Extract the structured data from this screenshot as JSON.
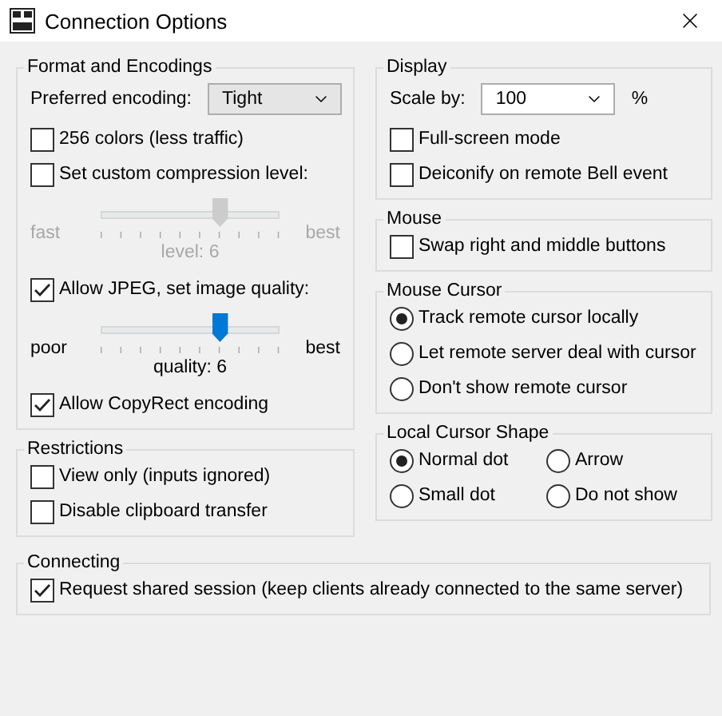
{
  "window": {
    "title": "Connection Options"
  },
  "left_column": [
    {
      "title": "Format and Encodings",
      "items": [
        {
          "kind": "select",
          "label": "Preferred encoding:",
          "value": "Tight"
        },
        {
          "kind": "checkbox",
          "label": "256 colors (less traffic)",
          "checked": false
        },
        {
          "kind": "checkbox",
          "label": "Set custom compression level:",
          "checked": false
        },
        {
          "kind": "slider",
          "left": "fast",
          "right": "best",
          "reading": "level: 6",
          "level": 0.667,
          "disabled": true
        },
        {
          "kind": "checkbox",
          "label": "Allow JPEG, set image quality:",
          "checked": true
        },
        {
          "kind": "slider",
          "left": "poor",
          "right": "best",
          "reading": "quality: 6",
          "level": 0.667,
          "disabled": false
        },
        {
          "kind": "checkbox",
          "label": "Allow CopyRect encoding",
          "checked": true
        }
      ]
    },
    {
      "title": "Restrictions",
      "items": [
        {
          "kind": "checkbox",
          "label": "View only (inputs ignored)",
          "checked": false
        },
        {
          "kind": "checkbox",
          "label": "Disable clipboard transfer",
          "checked": false
        }
      ]
    }
  ],
  "right_column": [
    {
      "title": "Display",
      "items": [
        {
          "kind": "select",
          "label": "Scale by:",
          "value": "100",
          "unit": "%"
        },
        {
          "kind": "checkbox",
          "label": "Full-screen mode",
          "checked": false
        },
        {
          "kind": "checkbox",
          "label": "Deiconify on remote Bell event",
          "checked": false
        }
      ]
    },
    {
      "title": "Mouse",
      "items": [
        {
          "kind": "checkbox",
          "label": "Swap right and middle buttons",
          "checked": false
        }
      ]
    },
    {
      "title": "Mouse Cursor",
      "items": [
        {
          "kind": "radio",
          "label": "Track remote cursor locally",
          "selected": true
        },
        {
          "kind": "radio",
          "label": "Let remote server deal with cursor",
          "selected": false
        },
        {
          "kind": "radio",
          "label": "Don't show remote cursor",
          "selected": false
        }
      ]
    },
    {
      "title": "Local Cursor Shape",
      "rows": [
        [
          {
            "kind": "radio",
            "label": "Normal dot",
            "selected": true
          },
          {
            "kind": "radio",
            "label": "Arrow",
            "selected": false
          }
        ],
        [
          {
            "kind": "radio",
            "label": "Small dot",
            "selected": false
          },
          {
            "kind": "radio",
            "label": "Do not show",
            "selected": false
          }
        ]
      ]
    }
  ],
  "bottom": [
    {
      "title": "Connecting",
      "items": [
        {
          "kind": "checkbox",
          "label": "Request shared session (keep clients already connected to the same server)",
          "checked": true
        }
      ]
    }
  ]
}
